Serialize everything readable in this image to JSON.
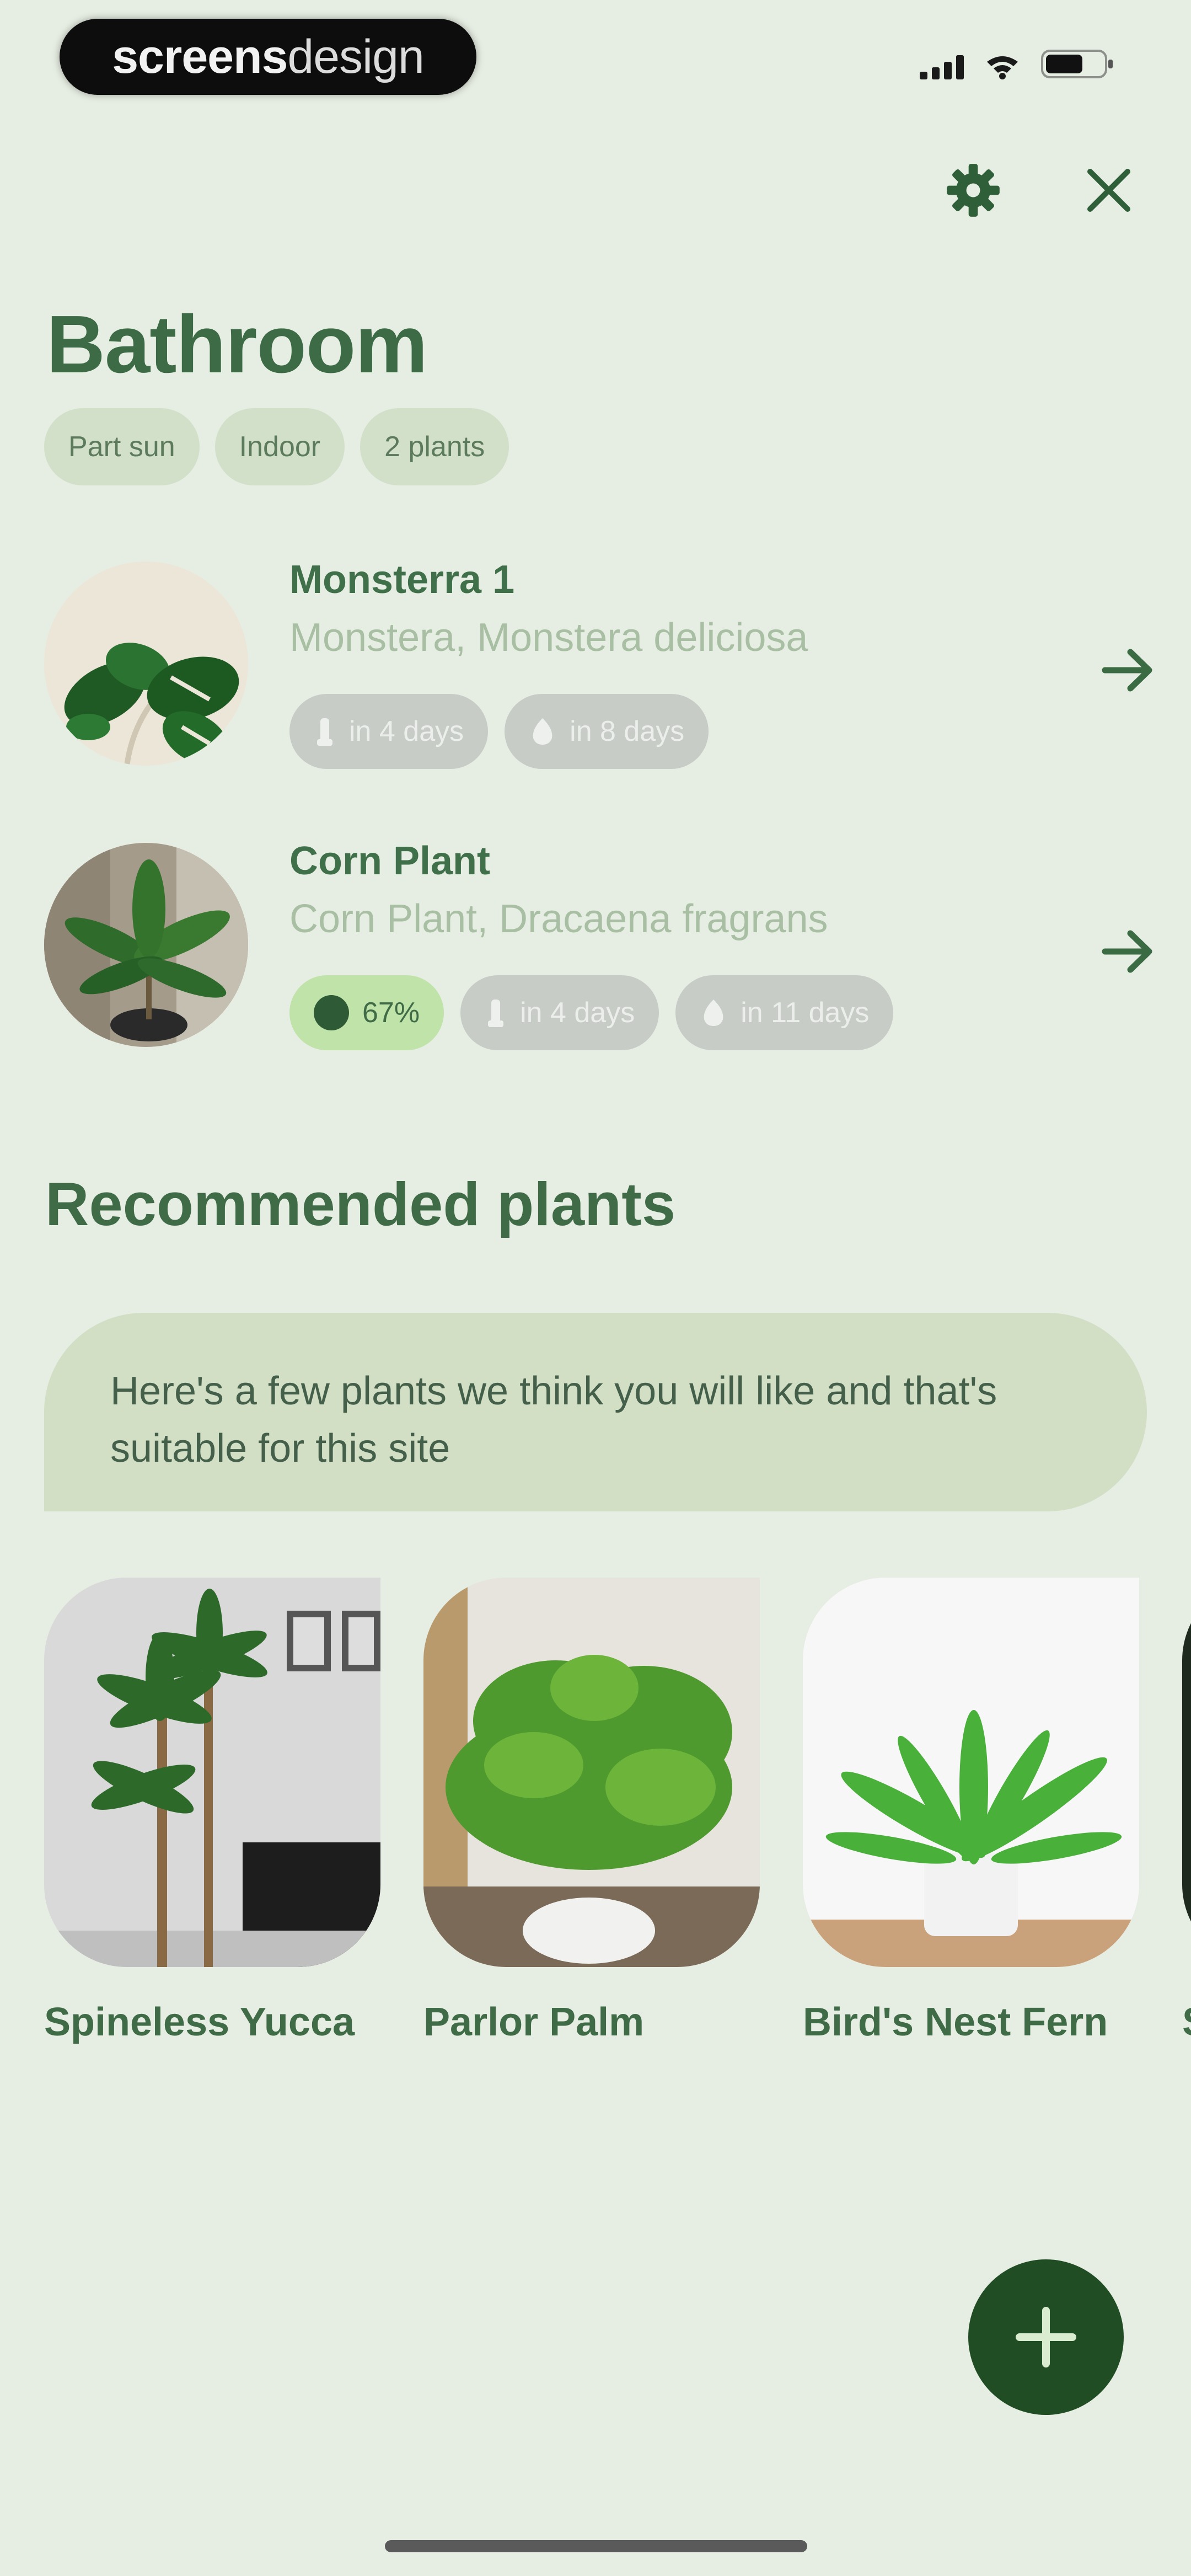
{
  "status_bar": {
    "logo_bold": "screens",
    "logo_light": "design"
  },
  "header": {
    "settings_icon": "gear-icon",
    "close_icon": "close-icon"
  },
  "site": {
    "title": "Bathroom",
    "tags": [
      "Part sun",
      "Indoor",
      "2 plants"
    ]
  },
  "plants": [
    {
      "name": "Monsterra 1",
      "species": "Monstera, Monstera deliciosa",
      "badges": [
        {
          "icon": "water-drop-icon",
          "label": "in 4 days"
        },
        {
          "icon": "fertilizer-icon",
          "label": "in 8 days"
        }
      ]
    },
    {
      "name": "Corn Plant",
      "species": "Corn Plant, Dracaena fragrans",
      "health": "67%",
      "badges": [
        {
          "icon": "water-drop-icon",
          "label": "in 4 days"
        },
        {
          "icon": "fertilizer-icon",
          "label": "in 11 days"
        }
      ]
    }
  ],
  "recommended": {
    "title": "Recommended plants",
    "info": "Here's a few plants we think you will like and that's suitable for this site",
    "items": [
      {
        "name": "Spineless Yucca"
      },
      {
        "name": "Parlor Palm"
      },
      {
        "name": "Bird's Nest Fern"
      },
      {
        "name": "S"
      }
    ]
  },
  "fab": {
    "icon": "plus-icon"
  },
  "colors": {
    "background": "#e6ede2",
    "accent": "#3f6b47",
    "fab": "#214d24",
    "chip": "#d3e0c9",
    "badge_grey": "#c7ccc6",
    "health_badge": "#bfe3a8"
  }
}
